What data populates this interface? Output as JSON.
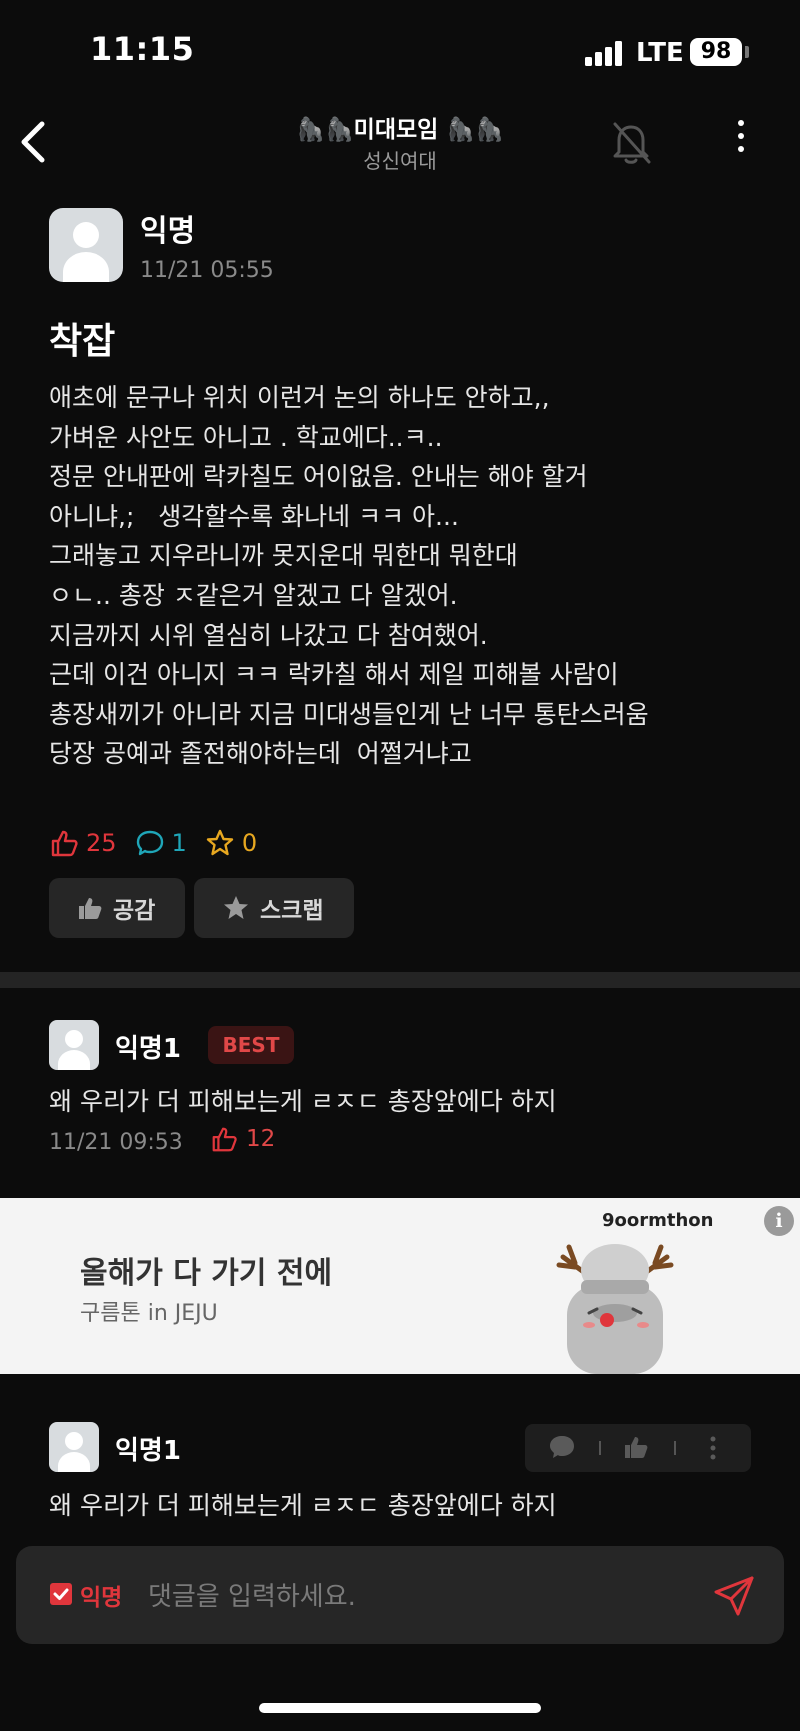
{
  "status_bar": {
    "time": "11:15",
    "network": "LTE",
    "battery": "98"
  },
  "nav": {
    "title": "🦍🦍미대모임 🦍🦍",
    "subtitle": "성신여대"
  },
  "post": {
    "author": "익명",
    "date": "11/21 05:55",
    "title": "착잡",
    "body": "애초에 문구나 위치 이런거 논의 하나도 안하고,,\n가벼운 사안도 아니고 . 학교에다..ㅋ..\n정문 안내판에 락카칠도 어이없음. 안내는 해야 할거\n아니냐,;   생각할수록 화나네 ㅋㅋ 아...\n그래놓고 지우라니까 못지운대 뭐한대 뭐한대\nㅇㄴ.. 총장 ㅈ같은거 알겠고 다 알겠어.\n지금까지 시위 열심히 나갔고 다 참여했어.\n근데 이건 아니지 ㅋㅋ 락카칠 해서 제일 피해볼 사람이\n총장새끼가 아니라 지금 미대생들인게 난 너무 통탄스러움\n당장 공예과 졸전해야하는데  어쩔거냐고",
    "stats": {
      "likes": "25",
      "comments": "1",
      "scraps": "0"
    },
    "buttons": {
      "like": "공감",
      "scrap": "스크랩"
    }
  },
  "best_comment": {
    "author": "익명1",
    "badge": "BEST",
    "text": "왜 우리가 더 피해보는게 ㄹㅈㄷ 총장앞에다 하지",
    "date": "11/21 09:53",
    "likes": "12"
  },
  "ad": {
    "title": "올해가 다 가기 전에",
    "subtitle": "구름톤 in JEJU",
    "brand": "9oormthon",
    "info_icon": "i"
  },
  "comment": {
    "author": "익명1",
    "text": "왜 우리가 더 피해보는게 ㄹㅈㄷ 총장앞에다 하지"
  },
  "input": {
    "anon_label": "익명",
    "placeholder": "댓글을 입력하세요."
  },
  "colors": {
    "accent": "#e0363c",
    "background": "#0c0c0c",
    "comment_icon": "#1fa6b8",
    "star": "#e8a820"
  }
}
